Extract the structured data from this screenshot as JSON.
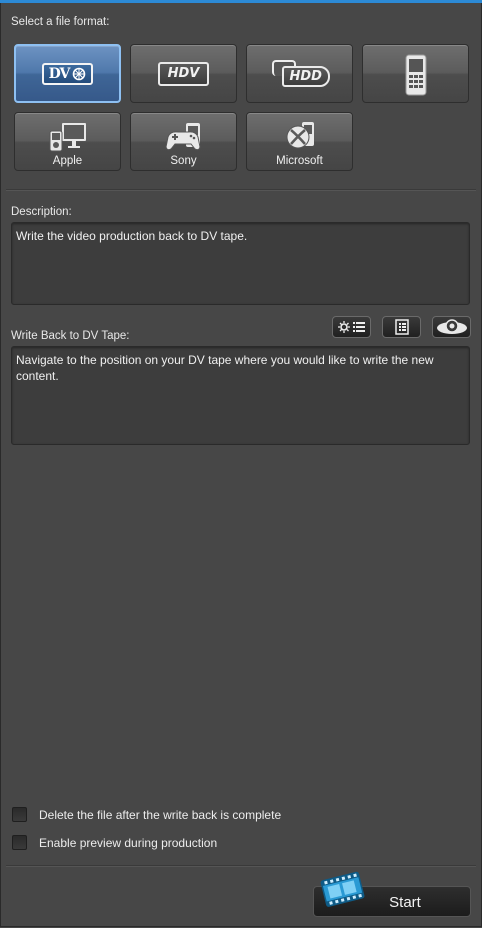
{
  "accent": "#2c8ad6",
  "format_section": {
    "label": "Select a file format:"
  },
  "formats": [
    {
      "id": "dv",
      "badge": "DV",
      "selected": true
    },
    {
      "id": "hdv",
      "badge": "HDV",
      "selected": false
    },
    {
      "id": "hdd",
      "badge": "HDD",
      "selected": false
    },
    {
      "id": "mobile",
      "icon": "mobile-phone-icon",
      "selected": false
    },
    {
      "id": "apple",
      "caption": "Apple",
      "icon": "apple-devices-icon",
      "selected": false
    },
    {
      "id": "sony",
      "caption": "Sony",
      "icon": "sony-gamepad-icon",
      "selected": false
    },
    {
      "id": "microsoft",
      "caption": "Microsoft",
      "icon": "xbox-icon",
      "selected": false
    }
  ],
  "description": {
    "label": "Description:",
    "text": "Write the video production back to DV tape."
  },
  "write_back": {
    "label": "Write Back to DV Tape:",
    "text": "Navigate to the position on your DV tape where you would like to write the new content."
  },
  "toolbar": {
    "buttons": [
      {
        "icon": "settings-list-icon"
      },
      {
        "icon": "info-list-icon"
      },
      {
        "icon": "preview-eye-icon"
      }
    ]
  },
  "options": {
    "delete_after": {
      "label": "Delete the file after the write back is complete",
      "checked": false
    },
    "enable_preview": {
      "label": "Enable preview during production",
      "checked": false
    }
  },
  "start_button": {
    "label": "Start",
    "icon": "film-strip-icon"
  }
}
